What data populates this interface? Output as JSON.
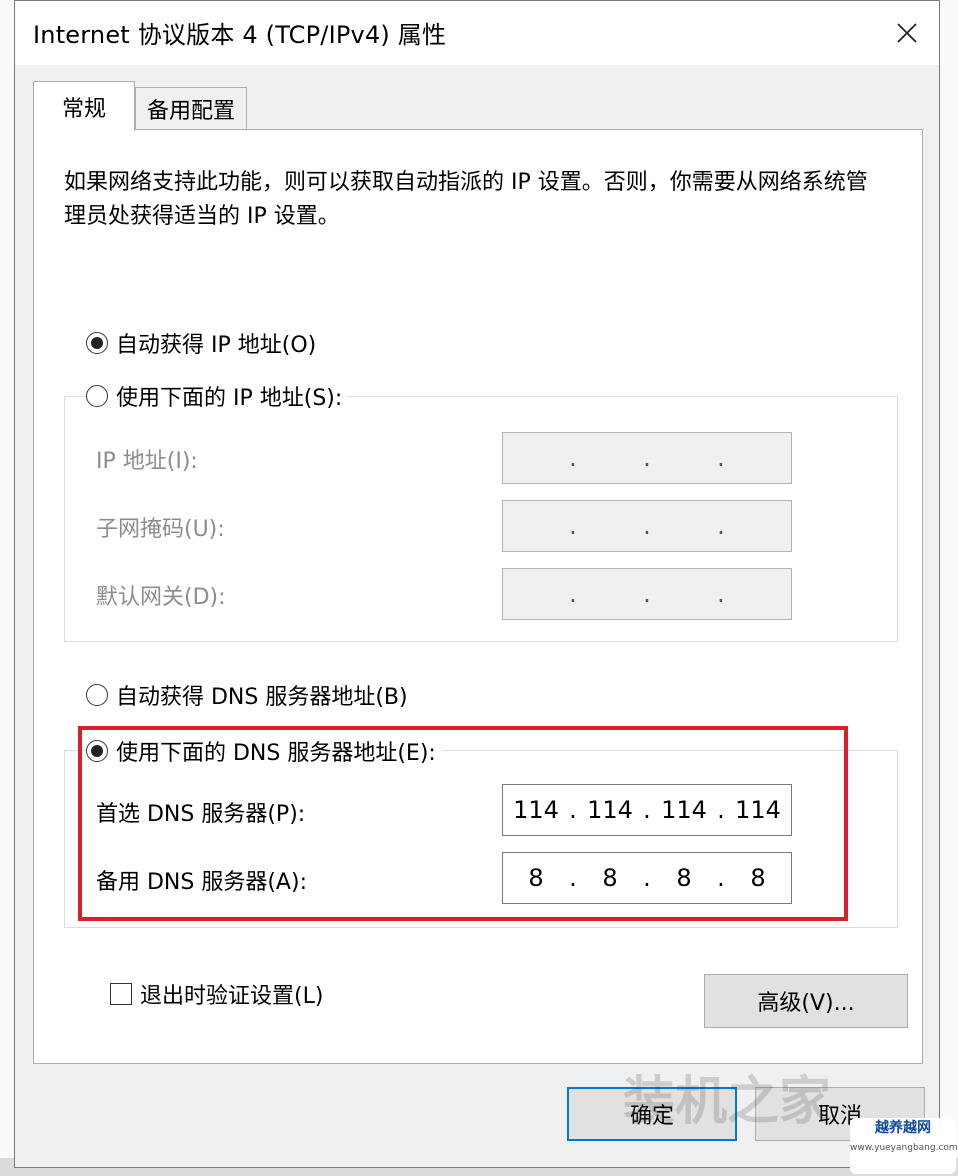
{
  "window": {
    "title": "Internet 协议版本 4 (TCP/IPv4) 属性"
  },
  "tabs": [
    {
      "label": "常规",
      "active": true
    },
    {
      "label": "备用配置",
      "active": false
    }
  ],
  "description": "如果网络支持此功能，则可以获取自动指派的 IP 设置。否则，你需要从网络系统管理员处获得适当的 IP 设置。",
  "ip": {
    "auto_label": "自动获得 IP 地址(O)",
    "auto_selected": true,
    "manual_label": "使用下面的 IP 地址(S):",
    "manual_selected": false,
    "fields": [
      {
        "label": "IP 地址(I):",
        "segments": [
          "",
          "",
          "",
          ""
        ]
      },
      {
        "label": "子网掩码(U):",
        "segments": [
          "",
          "",
          "",
          ""
        ]
      },
      {
        "label": "默认网关(D):",
        "segments": [
          "",
          "",
          "",
          ""
        ]
      }
    ]
  },
  "dns": {
    "auto_label": "自动获得 DNS 服务器地址(B)",
    "auto_selected": false,
    "manual_label": "使用下面的 DNS 服务器地址(E):",
    "manual_selected": true,
    "fields": [
      {
        "label": "首选 DNS 服务器(P):",
        "segments": [
          "114",
          "114",
          "114",
          "114"
        ]
      },
      {
        "label": "备用 DNS 服务器(A):",
        "segments": [
          "8",
          "8",
          "8",
          "8"
        ]
      }
    ]
  },
  "validate_on_exit": {
    "label": "退出时验证设置(L)",
    "checked": false
  },
  "buttons": {
    "advanced": "高级(V)...",
    "ok": "确定",
    "cancel": "取消"
  },
  "watermark": {
    "text": "装机之家",
    "badge_title": "越养越网",
    "badge_url": "www.yueyangbang.com"
  },
  "colors": {
    "highlight": "#d9202a",
    "default_button_border": "#0078d7",
    "dialog_bg": "#f0f0f0"
  }
}
